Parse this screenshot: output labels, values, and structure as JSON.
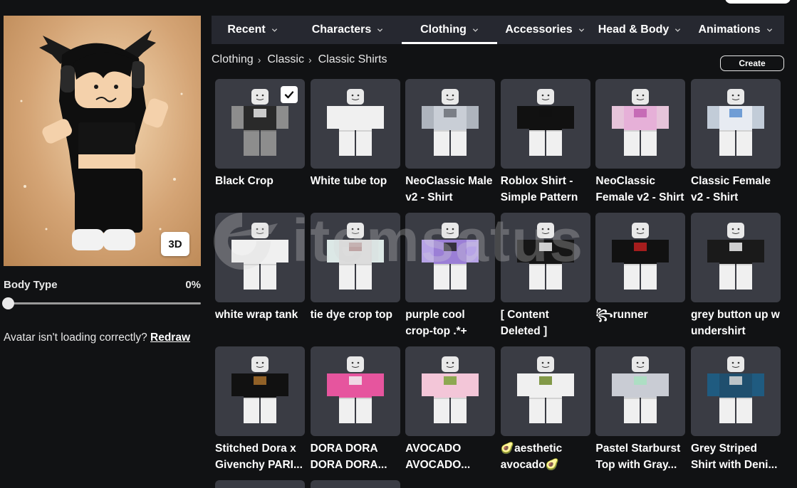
{
  "avatar": {
    "view_3d_label": "3D",
    "body_type_label": "Body Type",
    "body_type_value": "0%",
    "body_type_fraction": 0,
    "loading_issue_text": "Avatar isn't loading correctly?",
    "redraw_label": "Redraw"
  },
  "tabs": [
    {
      "label": "Recent",
      "active": false
    },
    {
      "label": "Characters",
      "active": false
    },
    {
      "label": "Clothing",
      "active": true
    },
    {
      "label": "Accessories",
      "active": false
    },
    {
      "label": "Head & Body",
      "active": false
    },
    {
      "label": "Animations",
      "active": false
    }
  ],
  "breadcrumb": [
    "Clothing",
    "Classic",
    "Classic Shirts"
  ],
  "create_label": "Create",
  "watermark": "itemsatus",
  "items": [
    {
      "name": "Black Crop",
      "selected": true,
      "shirt": "#2a2a2a",
      "accent": "#e8e8e8",
      "pants": "#8d8d8d",
      "arms": "#8d8d8d"
    },
    {
      "name": "White tube top",
      "selected": false,
      "shirt": "#f0f0f0",
      "accent": "#f0f0f0",
      "pants": "#f0f0f0",
      "arms": "#f0f0f0"
    },
    {
      "name": "NeoClassic Male v2 - Shirt",
      "selected": false,
      "shirt": "#c9ced6",
      "accent": "#6c7078",
      "pants": "#f0f0f0",
      "arms": "#aeb4bd"
    },
    {
      "name": "Roblox Shirt - Simple Pattern",
      "selected": false,
      "shirt": "#111111",
      "accent": "#111111",
      "pants": "#f0f0f0",
      "arms": "#111111"
    },
    {
      "name": "NeoClassic Female v2 - Shirt",
      "selected": false,
      "shirt": "#e6b0d8",
      "accent": "#c060b0",
      "pants": "#f0f0f0",
      "arms": "#e6c4da"
    },
    {
      "name": "Classic Female v2 - Shirt",
      "selected": false,
      "shirt": "#e7ebf2",
      "accent": "#5b8fd0",
      "pants": "#f0f0f0",
      "arms": "#c2ccd8"
    },
    {
      "name": "white wrap tank",
      "selected": false,
      "shirt": "#f0f0f0",
      "accent": "#f0f0f0",
      "pants": "#f0f0f0",
      "arms": "#f0f0f0"
    },
    {
      "name": "tie dye crop top",
      "selected": false,
      "shirt": "#dcdcdc",
      "accent": "#b89a9a",
      "pants": "#f0f0f0",
      "arms": "#dce8e6"
    },
    {
      "name": "purple cool crop-top .*+",
      "selected": false,
      "shirt": "#9b7fd6",
      "accent": "#222222",
      "pants": "#f0f0f0",
      "arms": "#b7a4e6"
    },
    {
      "name": "[ Content Deleted ]",
      "selected": false,
      "shirt": "#161616",
      "accent": "#f0f0f0",
      "pants": "#f0f0f0",
      "arms": "#161616"
    },
    {
      "name": "꧂runner",
      "selected": false,
      "shirt": "#111111",
      "accent": "#c02020",
      "pants": "#f0f0f0",
      "arms": "#111111"
    },
    {
      "name": "grey button up w undershirt",
      "selected": false,
      "shirt": "#1a1a1a",
      "accent": "#f0f0f0",
      "pants": "#f0f0f0",
      "arms": "#1a1a1a"
    },
    {
      "name": "Stitched Dora x Givenchy PARI...",
      "selected": false,
      "shirt": "#111111",
      "accent": "#a8702c",
      "pants": "#f0f0f0",
      "arms": "#111111"
    },
    {
      "name": "DORA DORA DORA DORA...",
      "selected": false,
      "shirt": "#e6559e",
      "accent": "#f0f0f0",
      "pants": "#f0f0f0",
      "arms": "#e6559e"
    },
    {
      "name": "AVOCADO AVOCADO...",
      "selected": false,
      "shirt": "#f3c6d8",
      "accent": "#7aa23a",
      "pants": "#f0f0f0",
      "arms": "#f3c6d8"
    },
    {
      "name": "🥑aesthetic avocado🥑",
      "selected": false,
      "shirt": "#f0f0f0",
      "accent": "#6f8a2a",
      "pants": "#f0f0f0",
      "arms": "#f0f0f0"
    },
    {
      "name": "Pastel Starburst Top with Gray...",
      "selected": false,
      "shirt": "#c9ccd4",
      "accent": "#a8e0c0",
      "pants": "#f0f0f0",
      "arms": "#c9ccd4"
    },
    {
      "name": "Grey Striped Shirt with Deni...",
      "selected": false,
      "shirt": "#1f4f6e",
      "accent": "#d8d8d8",
      "pants": "#f0f0f0",
      "arms": "#1f5b80"
    }
  ]
}
